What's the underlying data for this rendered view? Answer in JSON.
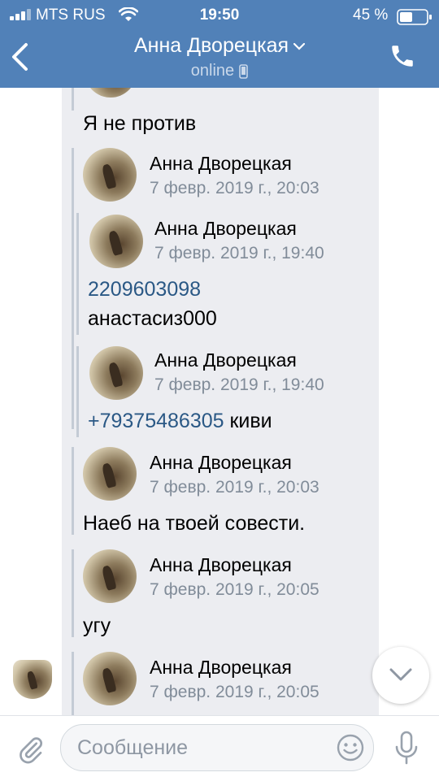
{
  "status_bar": {
    "carrier": "MTS RUS",
    "time": "19:50",
    "battery": "45 %"
  },
  "header": {
    "name": "Анна Дворецкая",
    "status": "online"
  },
  "messages": {
    "top_text": "Я не против",
    "m1": {
      "name": "Анна Дворецкая",
      "date": "7 февр. 2019 г., 20:03"
    },
    "f1": {
      "name": "Анна Дворецкая",
      "date": "7 февр. 2019 г., 19:40",
      "link": "2209603098",
      "line2": "анастасиз000"
    },
    "f2": {
      "name": "Анна Дворецкая",
      "date": "7 февр. 2019 г., 19:40",
      "link": "+79375486305",
      "rest": " киви"
    },
    "m2": {
      "name": "Анна Дворецкая",
      "date": "7 февр. 2019 г., 20:03",
      "text": "Наеб на твоей совести."
    },
    "m3": {
      "name": "Анна Дворецкая",
      "date": "7 февр. 2019 г., 20:05",
      "text": "угу"
    },
    "m4": {
      "name": "Анна Дворецкая",
      "date": "7 февр. 2019 г., 20:05"
    }
  },
  "input": {
    "placeholder": "Сообщение"
  },
  "icons": [
    "signal-icon",
    "wifi-icon",
    "battery-icon",
    "back-icon",
    "chevron-down-icon",
    "mobile-device-icon",
    "phone-icon",
    "scroll-down-icon",
    "attach-icon",
    "emoji-icon",
    "microphone-icon"
  ],
  "colors": {
    "header": "#5181b8",
    "link": "#2a5885",
    "bubble": "#ecedf1",
    "secondary_text": "#818c99"
  }
}
